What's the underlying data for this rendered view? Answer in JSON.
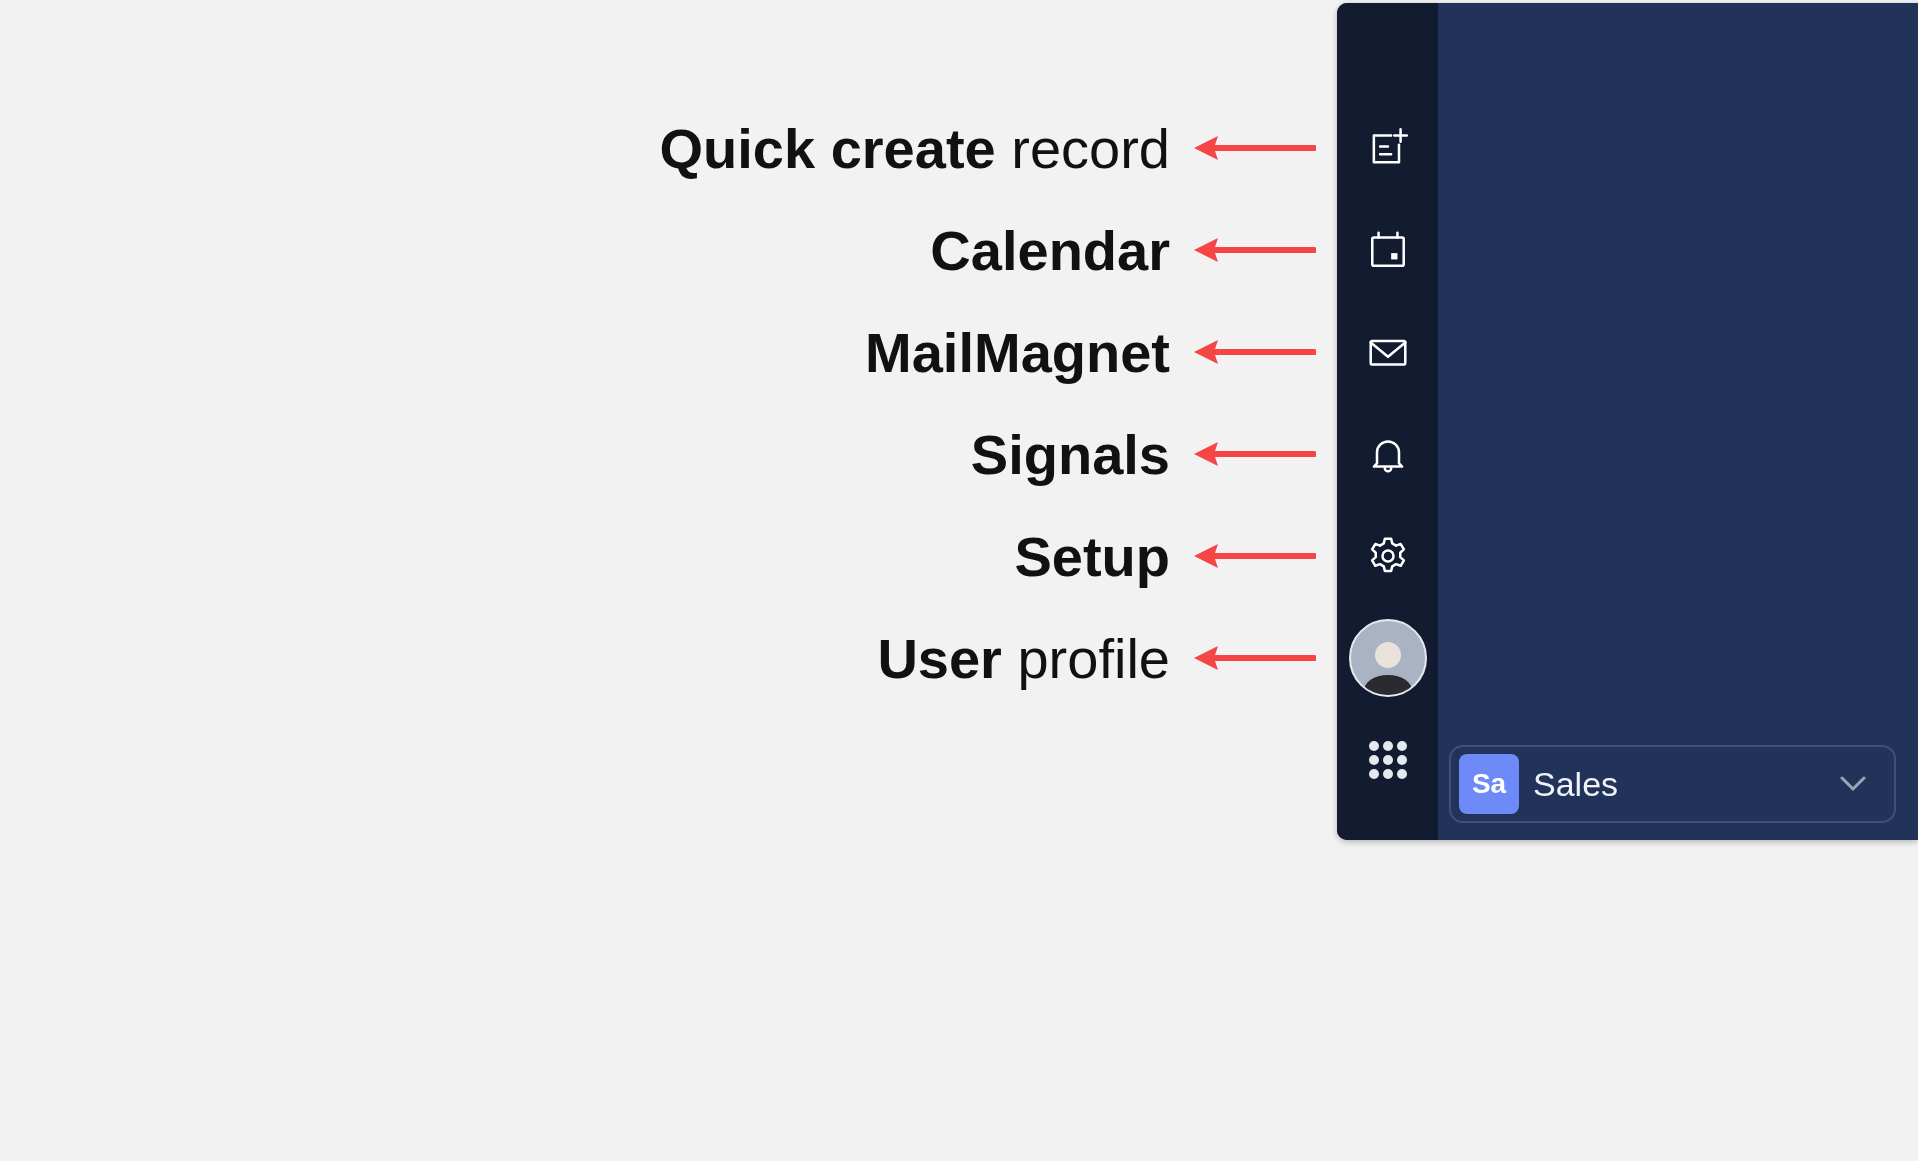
{
  "annotations": [
    {
      "label": "**Quick create** record"
    },
    {
      "label": "Calendar"
    },
    {
      "label": "MailMagnet"
    },
    {
      "label": "Signals"
    },
    {
      "label": "Setup"
    },
    {
      "label": "**User** profile"
    }
  ],
  "workspace_selector": {
    "badge": "Sa",
    "label": "Sales"
  }
}
